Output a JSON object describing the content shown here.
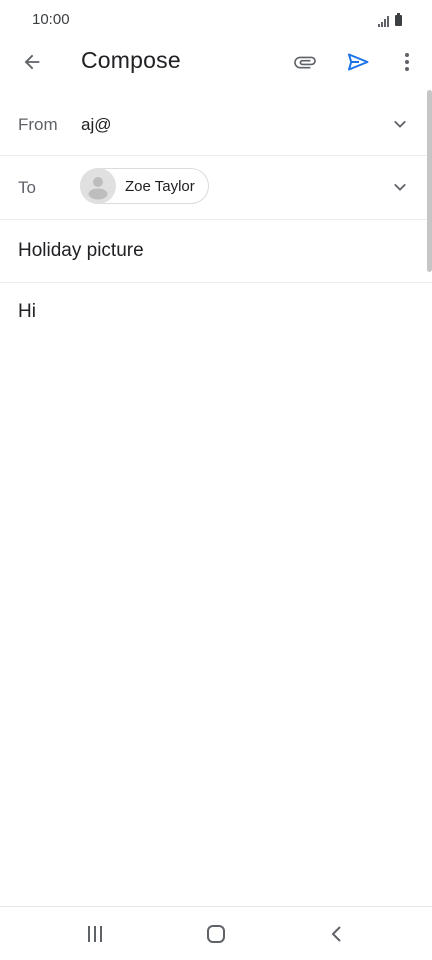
{
  "status_bar": {
    "time": "10:00",
    "signal_icon": "signal-icon",
    "battery_icon": "battery-icon"
  },
  "app_bar": {
    "title": "Compose",
    "back_icon": "arrow-back-icon",
    "attach_icon": "paperclip-icon",
    "send_icon": "send-icon",
    "more_icon": "more-vert-icon"
  },
  "from": {
    "label": "From",
    "value": "aj@"
  },
  "to": {
    "label": "To",
    "recipients": [
      {
        "name": "Zoe Taylor"
      }
    ]
  },
  "subject": {
    "value": "Holiday picture"
  },
  "body": {
    "value": "Hi"
  },
  "colors": {
    "send_accent": "#1a73e8",
    "icon_gray": "#5f6368",
    "text_primary": "#202124"
  },
  "nav_bar": {
    "recent_icon": "recent-apps-icon",
    "home_icon": "home-icon",
    "back_icon": "nav-back-icon"
  }
}
